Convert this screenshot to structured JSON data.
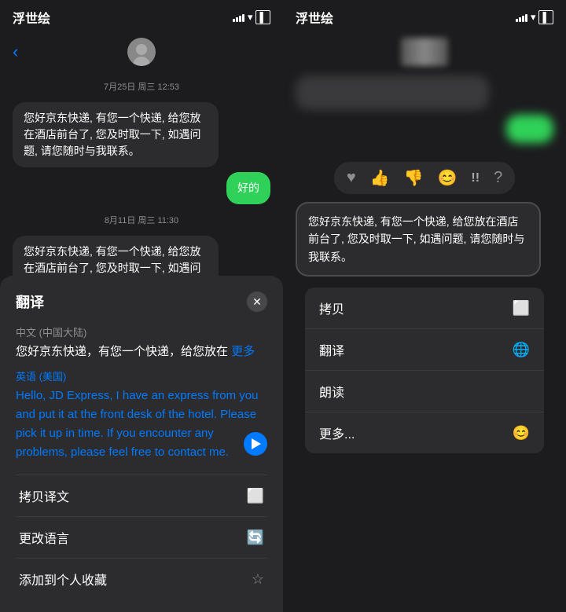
{
  "app": {
    "title_left": "浮世绘",
    "title_right": "浮世绘"
  },
  "left": {
    "nav": {
      "back_symbol": "‹",
      "contact_name": ""
    },
    "chat": {
      "date1": "7月25日 周三 12:53",
      "msg1": "您好京东快递, 有您一个快递, 给您放在酒店前台了, 您及时取一下, 如遇问题, 请您随时与我联系。",
      "msg2": "好的",
      "date2": "8月11日 周三 11:30",
      "msg3": "您好京东快递, 有您一个快递, 给您放在酒店前台了, 您及时取一下, 如遇问题, 请您随时与我联系。"
    },
    "translation": {
      "title": "翻译",
      "source_lang": "中文 (中国大陆)",
      "source_text": "您好京东快递，有您一个快递，给您放在",
      "more": "更多",
      "target_lang": "英语 (美国)",
      "target_text": "Hello, JD Express, I have an express from you and put it at the front desk of the hotel. Please pick it up in time. If you encounter any problems, please feel free to contact me.",
      "menu": [
        {
          "label": "拷贝译文",
          "icon": "⬜"
        },
        {
          "label": "更改语言",
          "icon": "🔄"
        },
        {
          "label": "添加到个人收藏",
          "icon": "☆"
        }
      ]
    }
  },
  "right": {
    "chat": {
      "message": "您好京东快递, 有您一个快递, 给您放在酒店前台了, 您及时取一下, 如遇问题, 请您随时与我联系。"
    },
    "menu": [
      {
        "label": "拷贝",
        "icon": "📋"
      },
      {
        "label": "翻译",
        "icon": "🌐"
      },
      {
        "label": "朗读",
        "icon": ""
      },
      {
        "label": "更多...",
        "icon": "😊"
      }
    ]
  }
}
